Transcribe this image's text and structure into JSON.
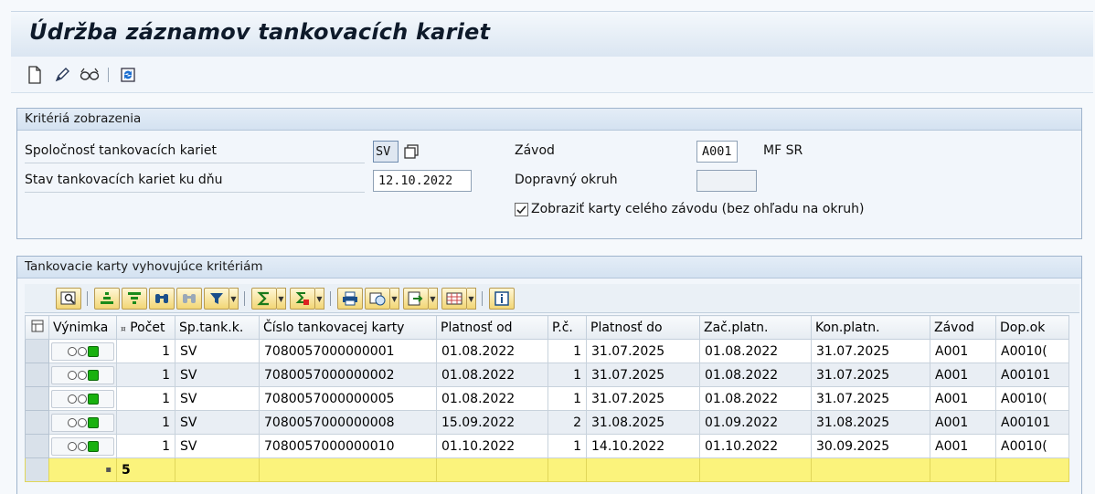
{
  "window": {
    "title": "Údržba záznamov tankovacích kariet"
  },
  "toolbar": {
    "icons": [
      "create-icon",
      "edit-icon",
      "display-icon",
      "refresh-icon"
    ]
  },
  "criteria": {
    "title": "Kritériá zobrazenia",
    "company_label": "Spoločnosť tankovacích kariet",
    "company_value": "SV",
    "state_label": "Stav tankovacích kariet ku dňu",
    "state_value": "12.10.2022",
    "plant_label": "Závod",
    "plant_value": "A001",
    "plant_desc": "MF SR",
    "transport_label": "Dopravný okruh",
    "transport_value": "",
    "show_all_label": "Zobraziť karty celého závodu (bez ohľadu na okruh)",
    "show_all_checked": true
  },
  "results": {
    "title": "Tankovacie karty vyhovujúce kritériám",
    "columns": [
      "Výnimka",
      "Počet",
      "Sp.tank.k.",
      "Číslo tankovacej karty",
      "Platnosť od",
      "P.č.",
      "Platnosť do",
      "Zač.platn.",
      "Kon.platn.",
      "Závod",
      "Dop.ok"
    ],
    "rows": [
      [
        "",
        "1",
        "SV",
        "7080057000000001",
        "01.08.2022",
        "1",
        "31.07.2025",
        "01.08.2022",
        "31.07.2025",
        "A001",
        "A0010("
      ],
      [
        "",
        "1",
        "SV",
        "7080057000000002",
        "01.08.2022",
        "1",
        "31.07.2025",
        "01.08.2022",
        "31.07.2025",
        "A001",
        "A00101"
      ],
      [
        "",
        "1",
        "SV",
        "7080057000000005",
        "01.08.2022",
        "1",
        "31.07.2025",
        "01.08.2022",
        "31.07.2025",
        "A001",
        "A0010("
      ],
      [
        "",
        "1",
        "SV",
        "7080057000000008",
        "15.09.2022",
        "2",
        "31.08.2025",
        "01.09.2022",
        "31.08.2025",
        "A001",
        "A00101"
      ],
      [
        "",
        "1",
        "SV",
        "7080057000000010",
        "01.10.2022",
        "1",
        "14.10.2022",
        "01.10.2022",
        "30.09.2025",
        "A001",
        "A0010("
      ]
    ],
    "total_marker": "▪",
    "total_count": "5"
  },
  "colors": {
    "title_bg": "#dbe6f2",
    "total_row": "#fbf37c",
    "row_alt": "#e9eef4",
    "lamp_green": "#19b10f"
  }
}
